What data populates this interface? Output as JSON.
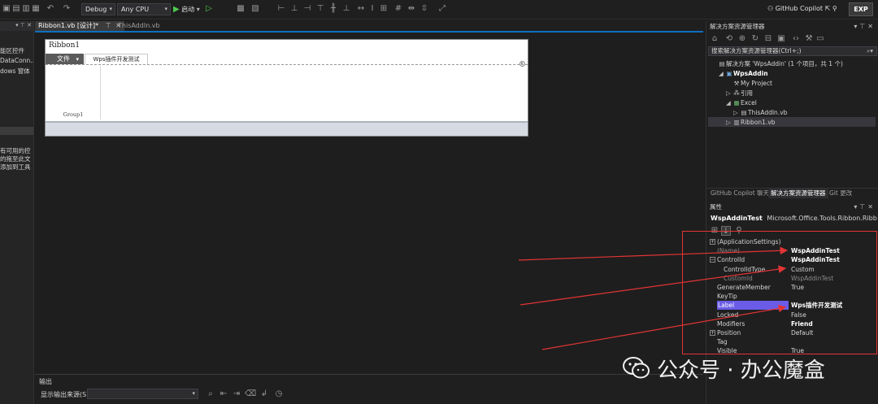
{
  "toolbar": {
    "configuration": "Debug",
    "platform": "Any CPU",
    "run_label": "启动",
    "copilot_label": "GitHub Copilot",
    "exp_label": "EXP"
  },
  "left_panel": {
    "items_top": [
      "能区控件",
      "DataConn...",
      "dows 窗体"
    ],
    "items_bottom": [
      "有可用的控",
      "的拖至此文",
      "添加到工具"
    ]
  },
  "doc_tabs": [
    {
      "label": "Ribbon1.vb [设计]*",
      "active": true
    },
    {
      "label": "ThisAddIn.vb",
      "active": false
    }
  ],
  "designer": {
    "ribbon_title": "Ribbon1",
    "file_tab": "文件",
    "addin_tab": "Wps插件开发测试",
    "group_label": "Group1"
  },
  "output": {
    "title": "输出",
    "source_label": "显示输出来源(S):",
    "source_value": ""
  },
  "solution_explorer": {
    "title": "解决方案资源管理器",
    "search_placeholder": "搜索解决方案资源管理器(Ctrl+;)",
    "tree": [
      {
        "label": "解决方案 'WpsAddin' (1 个项目，共 1 个)",
        "icon": "solution-icon",
        "level": 0,
        "twisty": ""
      },
      {
        "label": "WpsAddin",
        "icon": "vb-project-icon",
        "level": 1,
        "twisty": "◢",
        "bold": true
      },
      {
        "label": "My Project",
        "icon": "wrench-icon",
        "level": 2,
        "twisty": ""
      },
      {
        "label": "引用",
        "icon": "references-icon",
        "level": 2,
        "twisty": "▷"
      },
      {
        "label": "Excel",
        "icon": "excel-icon",
        "level": 2,
        "twisty": "◢"
      },
      {
        "label": "ThisAddIn.vb",
        "icon": "vb-file-icon",
        "level": 3,
        "twisty": "▷"
      },
      {
        "label": "Ribbon1.vb",
        "icon": "ribbon-file-icon",
        "level": 2,
        "twisty": "▷"
      }
    ],
    "bottom_tabs": [
      "GitHub Copilot 聊天",
      "解决方案资源管理器",
      "Git 更改"
    ]
  },
  "properties": {
    "title": "属性",
    "object_name": "WspAddinTest",
    "object_type": "Microsoft.Office.Tools.Ribbon.RibbonTab",
    "rows": [
      {
        "name": "(ApplicationSettings)",
        "value": "",
        "expander": "+",
        "sub": false,
        "bold": false,
        "dim_name": false,
        "dim_value": false,
        "selected": false
      },
      {
        "name": "(Name)",
        "value": "WspAddinTest",
        "expander": "",
        "sub": false,
        "bold": true,
        "dim_name": true,
        "dim_value": false,
        "selected": false
      },
      {
        "name": "ControlId",
        "value": "WspAddinTest",
        "expander": "−",
        "sub": false,
        "bold": true,
        "dim_name": false,
        "dim_value": false,
        "selected": false
      },
      {
        "name": "ControlIdType",
        "value": "Custom",
        "expander": "",
        "sub": true,
        "bold": false,
        "dim_name": false,
        "dim_value": false,
        "selected": false
      },
      {
        "name": "CustomId",
        "value": "WspAddinTest",
        "expander": "",
        "sub": true,
        "bold": false,
        "dim_name": true,
        "dim_value": true,
        "selected": false
      },
      {
        "name": "GenerateMember",
        "value": "True",
        "expander": "",
        "sub": false,
        "bold": false,
        "dim_name": false,
        "dim_value": false,
        "selected": false
      },
      {
        "name": "KeyTip",
        "value": "",
        "expander": "",
        "sub": false,
        "bold": false,
        "dim_name": false,
        "dim_value": false,
        "selected": false
      },
      {
        "name": "Label",
        "value": "Wps插件开发测试",
        "expander": "",
        "sub": false,
        "bold": true,
        "dim_name": false,
        "dim_value": false,
        "selected": true
      },
      {
        "name": "Locked",
        "value": "False",
        "expander": "",
        "sub": false,
        "bold": false,
        "dim_name": false,
        "dim_value": false,
        "selected": false
      },
      {
        "name": "Modifiers",
        "value": "Friend",
        "expander": "",
        "sub": false,
        "bold": true,
        "dim_name": false,
        "dim_value": false,
        "selected": false
      },
      {
        "name": "Position",
        "value": "Default",
        "expander": "+",
        "sub": false,
        "bold": false,
        "dim_name": false,
        "dim_value": false,
        "selected": false
      },
      {
        "name": "Tag",
        "value": "",
        "expander": "",
        "sub": false,
        "bold": false,
        "dim_name": false,
        "dim_value": false,
        "selected": false
      },
      {
        "name": "Visible",
        "value": "True",
        "expander": "",
        "sub": false,
        "bold": false,
        "dim_name": false,
        "dim_value": false,
        "selected": false
      }
    ]
  },
  "annotation": {
    "color": "#e23434"
  },
  "watermark": {
    "text": "公众号 · 办公魔盒"
  }
}
